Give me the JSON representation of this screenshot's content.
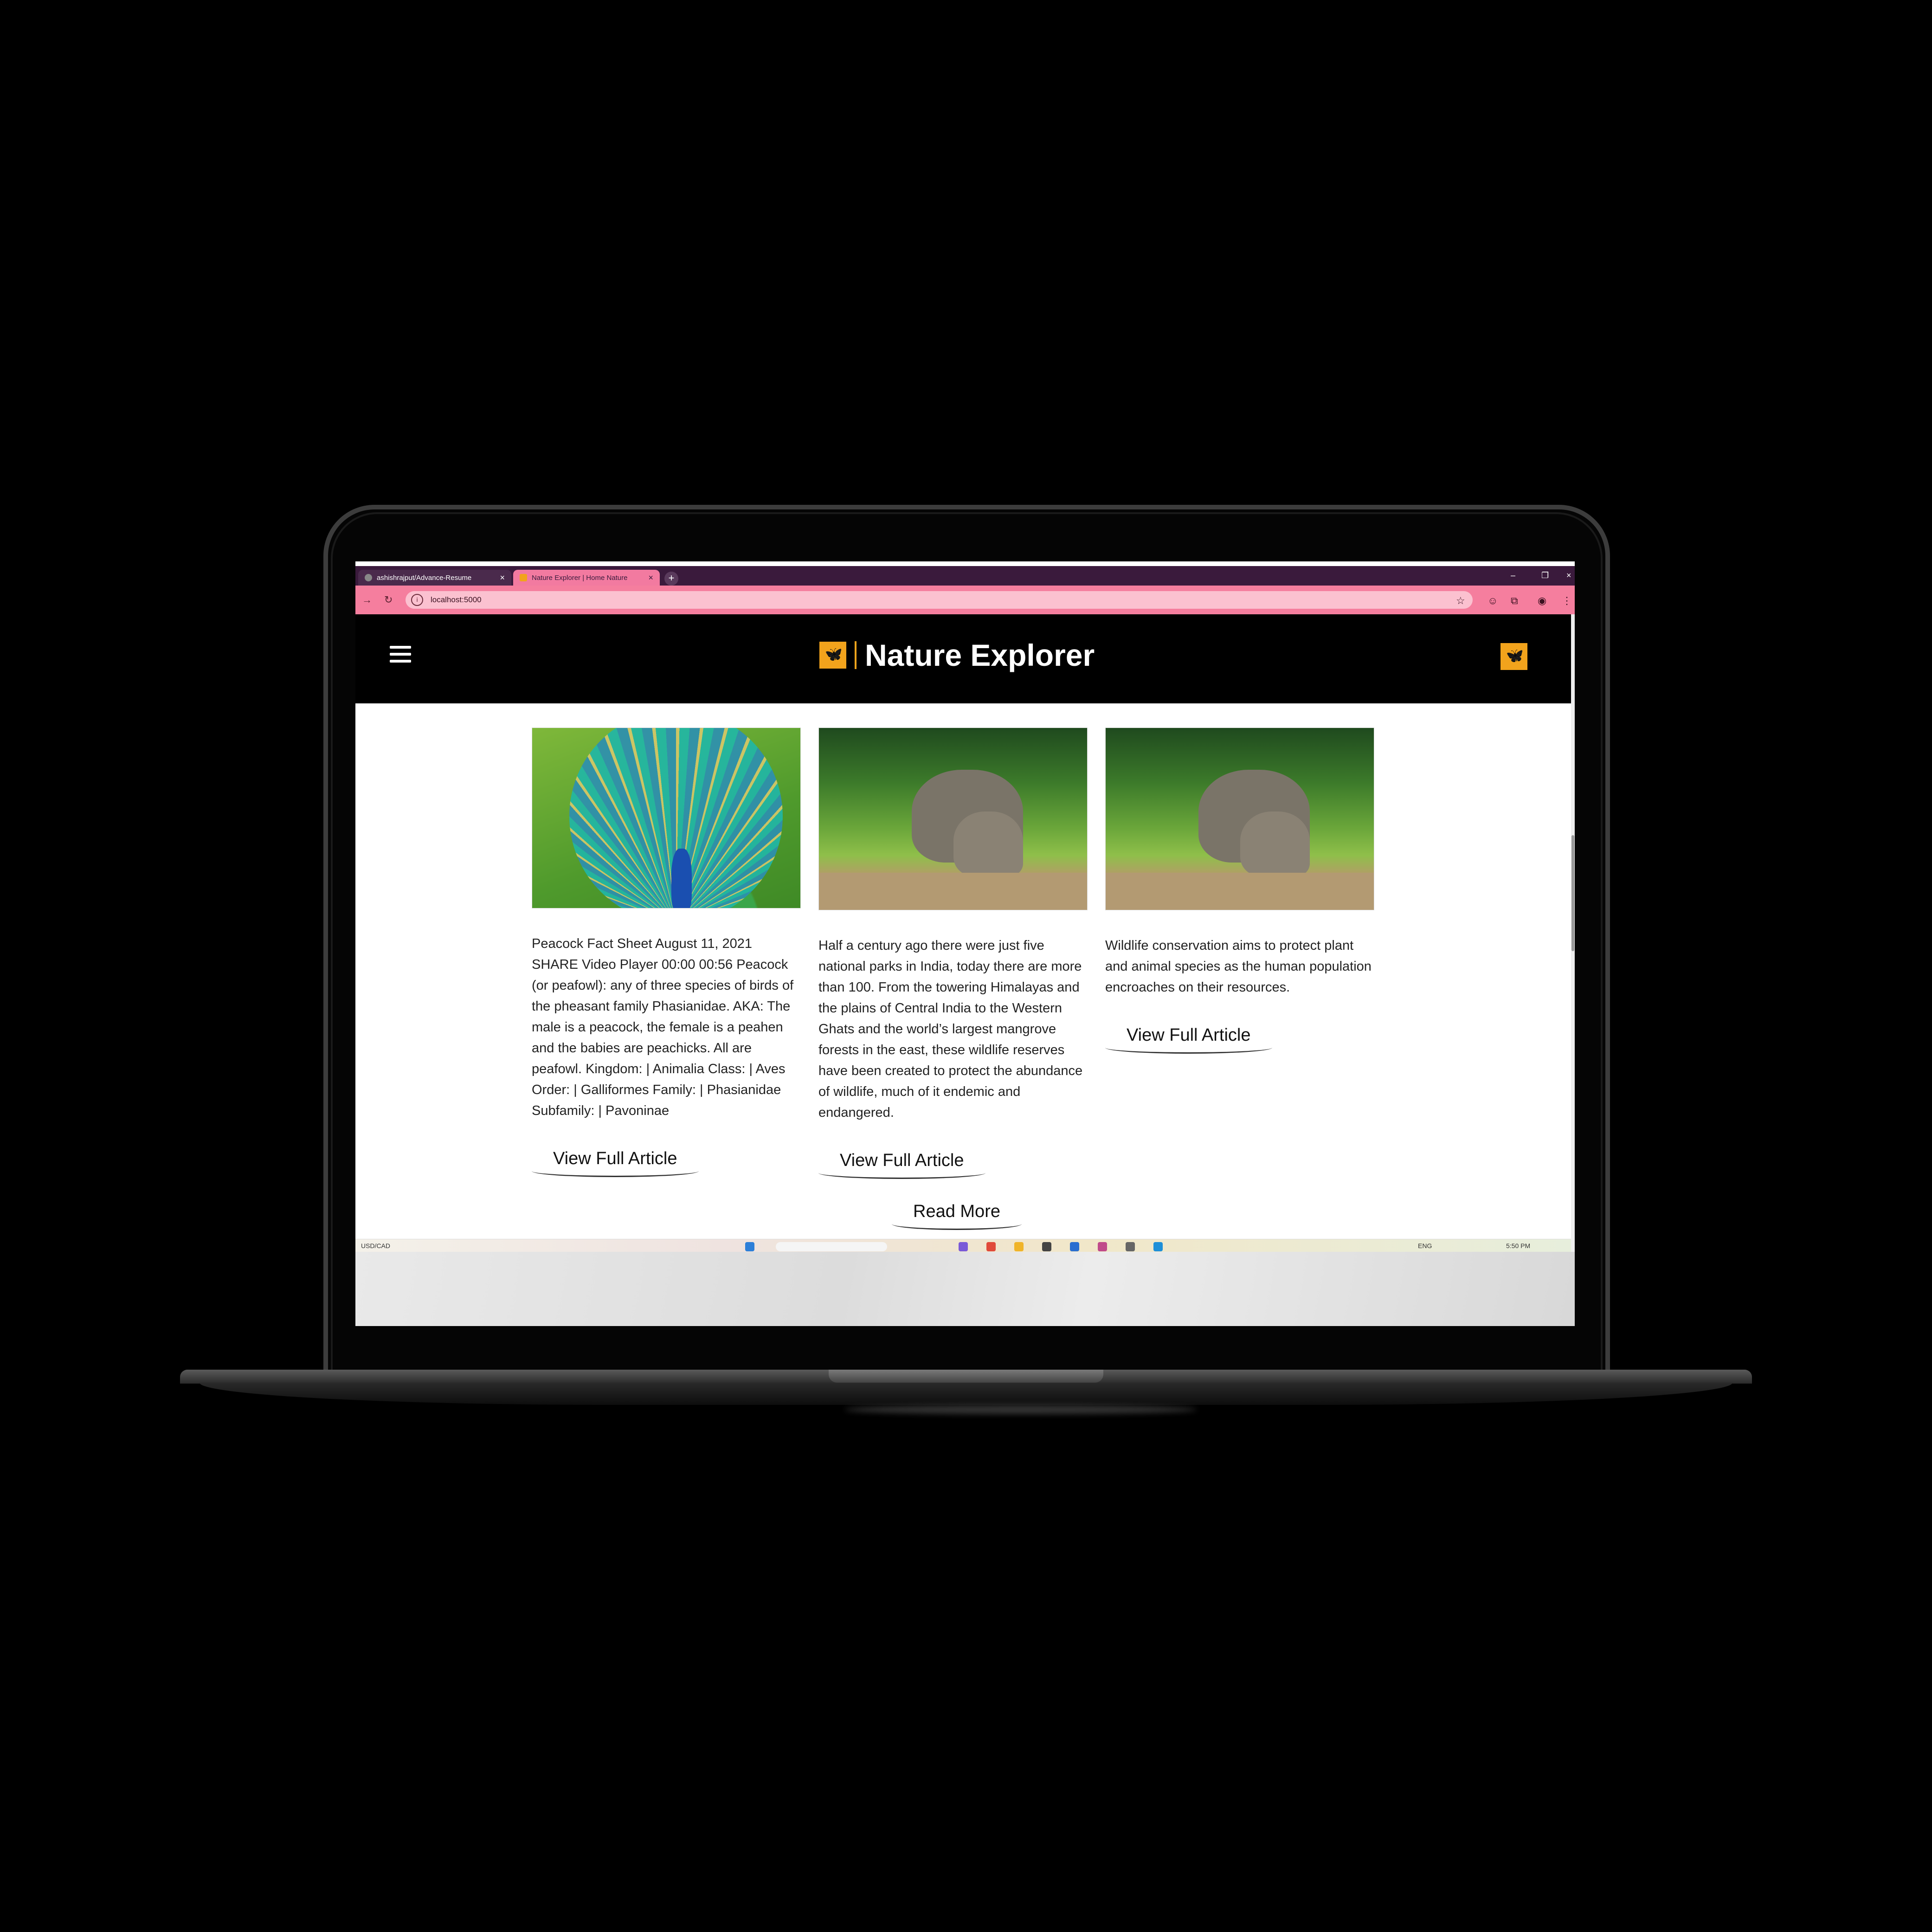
{
  "browser": {
    "tabs": [
      {
        "title": "ashishrajput/Advance-Resume"
      },
      {
        "title": "Nature Explorer | Home Nature"
      }
    ],
    "new_tab": "+",
    "url": "localhost:5000"
  },
  "site": {
    "brand": "Nature Explorer"
  },
  "articles": [
    {
      "image": "peacock",
      "text": "Peacock Fact Sheet August 11, 2021 SHARE Video Player 00:00 00:56 Peacock (or peafowl): any of three species of birds of the pheasant family Phasianidae. AKA: The male is a peacock, the female is a peahen and the babies are peachicks. All are peafowl. Kingdom: | Animalia Class: | Aves Order: | Galliformes Family: | Phasianidae Subfamily: | Pavoninae",
      "button": "View Full Article"
    },
    {
      "image": "elephants",
      "text": "Half a century ago there were just five national parks in India, today there are more than 100. From the towering Himalayas and the plains of Central India to the Western Ghats and the world’s largest mangrove forests in the east, these wildlife reserves have been created to protect the abundance of wildlife, much of it endemic and endangered.",
      "button": "View Full Article"
    },
    {
      "image": "elephants",
      "text": "Wildlife conservation aims to protect plant and animal species as the human population encroaches on their resources.",
      "button": "View Full Article"
    }
  ],
  "read_more": "Read More",
  "taskbar": {
    "ticker": "USD/CAD",
    "lang": "ENG",
    "time": "5:50 PM"
  },
  "colors": {
    "tabstrip": "#3a1a3c",
    "addressbar": "#f57e9e",
    "header": "#000000",
    "brand_accent": "#f2a31c"
  }
}
